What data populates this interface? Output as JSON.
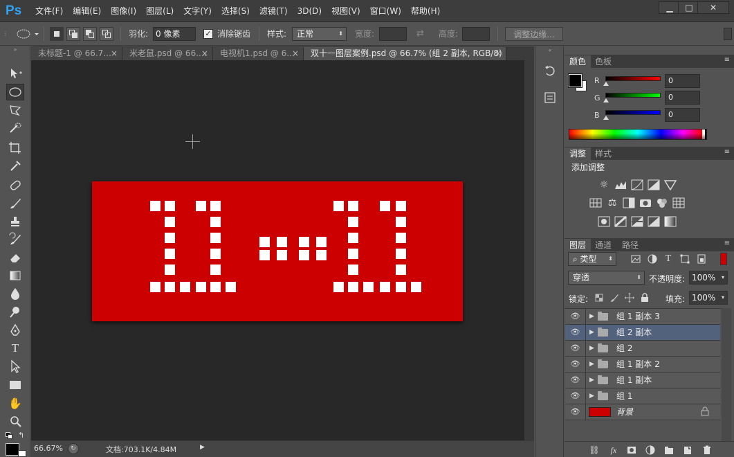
{
  "app": {
    "logo": "Ps",
    "menu": [
      "文件(F)",
      "编辑(E)",
      "图像(I)",
      "图层(L)",
      "文字(Y)",
      "选择(S)",
      "滤镜(T)",
      "3D(D)",
      "视图(V)",
      "窗口(W)",
      "帮助(H)"
    ],
    "window_buttons": {
      "minimize": "▁",
      "maximize": "□",
      "close": "✕"
    }
  },
  "options": {
    "feather_label": "羽化:",
    "feather_value": "0 像素",
    "antialias_label": "消除锯齿",
    "antialias_checked": true,
    "style_label": "样式:",
    "style_value": "正常",
    "width_label": "宽度:",
    "height_label": "高度:",
    "refine_button": "调整边缘..."
  },
  "tabs": [
    {
      "label": "未标题-1 @ 66.7...",
      "active": false
    },
    {
      "label": "米老鼠.psd @ 66....",
      "active": false
    },
    {
      "label": "电视机1.psd @ 6...",
      "active": false
    },
    {
      "label": "双十一图层案例.psd @ 66.7% (组 2 副本, RGB/8)",
      "active": true
    }
  ],
  "tab_close_glyph": "×",
  "status": {
    "zoom": "66.67%",
    "doc_info": "文档:703.1K/4.84M"
  },
  "color_panel": {
    "tabs": [
      "颜色",
      "色板"
    ],
    "foreground": "#000000",
    "background": "#ffffff",
    "channels": [
      {
        "name": "R",
        "value": "0",
        "color": "#ff0000"
      },
      {
        "name": "G",
        "value": "0",
        "color": "#00ff00"
      },
      {
        "name": "B",
        "value": "0",
        "color": "#0000ff"
      }
    ]
  },
  "adjust_panel": {
    "tabs": [
      "调整",
      "样式"
    ],
    "title": "添加调整"
  },
  "layers_panel": {
    "tabs": [
      "图层",
      "通道",
      "路径"
    ],
    "filter_label": "类型",
    "blend_mode": "穿透",
    "opacity_label": "不透明度:",
    "opacity_value": "100%",
    "lock_label": "锁定:",
    "fill_label": "填充:",
    "fill_value": "100%",
    "layers": [
      {
        "name": "组 1 副本 3",
        "type": "group",
        "selected": false
      },
      {
        "name": "组 2 副本",
        "type": "group",
        "selected": true
      },
      {
        "name": "组 2",
        "type": "group",
        "selected": false
      },
      {
        "name": "组 1 副本 2",
        "type": "group",
        "selected": false
      },
      {
        "name": "组 1 副本",
        "type": "group",
        "selected": false
      },
      {
        "name": "组 1",
        "type": "group",
        "selected": false
      },
      {
        "name": "背景",
        "type": "background",
        "selected": false,
        "locked": true,
        "thumb_color": "#cc0000"
      }
    ]
  },
  "colors": {
    "canvas_red": "#cc0000",
    "selection_highlight": "#52617c",
    "ps_blue": "#2fa3f6"
  }
}
